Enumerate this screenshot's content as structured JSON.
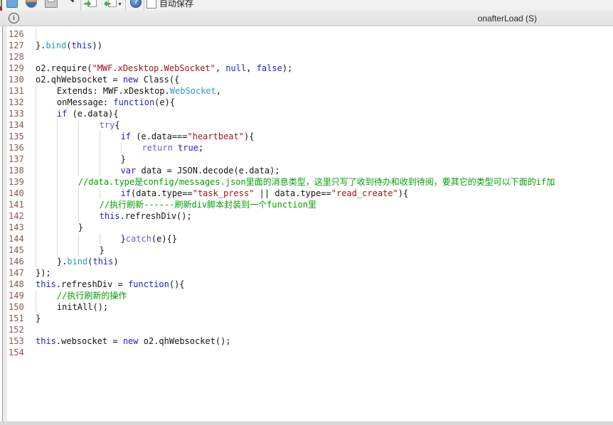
{
  "toolbar": {
    "autosave_label": "自动保存",
    "icons": [
      "new-document-icon",
      "globe-icon",
      "print-icon",
      "format-wand-icon",
      "export-document-icon",
      "import-document-icon",
      "help-icon"
    ]
  },
  "infobar": {
    "label": "onafterLoad (S)",
    "info_icon": "i"
  },
  "editor": {
    "colors": {
      "p": "#141414",
      "k": "#2121cd",
      "c": "#6f5bd8",
      "s": "#a31515",
      "m": "#00a000",
      "b": "#2e9ab8",
      "linenum": "#8f5252",
      "guide": "#d8d8d8"
    },
    "lines": [
      {
        "n": 126,
        "indent": 1,
        "tokens": []
      },
      {
        "n": 127,
        "indent": 0,
        "tokens": [
          [
            "}.",
            "p"
          ],
          [
            "bind",
            "b"
          ],
          [
            "(",
            "p"
          ],
          [
            "this",
            "k"
          ],
          [
            "))",
            "p"
          ]
        ]
      },
      {
        "n": 128,
        "indent": 0,
        "tokens": []
      },
      {
        "n": 129,
        "indent": 0,
        "tokens": [
          [
            "o2.require(",
            "p"
          ],
          [
            "\"MWF.xDesktop.WebSocket\"",
            "s"
          ],
          [
            ", ",
            "p"
          ],
          [
            "null",
            "k"
          ],
          [
            ", ",
            "p"
          ],
          [
            "false",
            "k"
          ],
          [
            ");",
            "p"
          ]
        ]
      },
      {
        "n": 130,
        "indent": 0,
        "tokens": [
          [
            "o2.qhWebsocket = ",
            "p"
          ],
          [
            "new",
            "k"
          ],
          [
            " Class({",
            "p"
          ]
        ]
      },
      {
        "n": 131,
        "indent": 1,
        "tokens": [
          [
            "Extends: MWF.xDesktop.",
            "p"
          ],
          [
            "WebSocket",
            "b"
          ],
          [
            ",",
            "p"
          ]
        ]
      },
      {
        "n": 132,
        "indent": 1,
        "tokens": [
          [
            "onMessage: ",
            "p"
          ],
          [
            "function",
            "k"
          ],
          [
            "(e){",
            "p"
          ]
        ]
      },
      {
        "n": 133,
        "indent": 1,
        "tokens": [
          [
            "if",
            "k"
          ],
          [
            " (e.data){",
            "p"
          ]
        ]
      },
      {
        "n": 134,
        "indent": 3,
        "tokens": [
          [
            "try",
            "c"
          ],
          [
            "{",
            "p"
          ]
        ]
      },
      {
        "n": 135,
        "indent": 4,
        "tokens": [
          [
            "if",
            "k"
          ],
          [
            " (e.data===",
            "p"
          ],
          [
            "\"heartbeat\"",
            "s"
          ],
          [
            "){",
            "p"
          ]
        ]
      },
      {
        "n": 136,
        "indent": 5,
        "tokens": [
          [
            "return",
            "c"
          ],
          [
            " ",
            "p"
          ],
          [
            "true",
            "k"
          ],
          [
            ";",
            "p"
          ]
        ]
      },
      {
        "n": 137,
        "indent": 4,
        "tokens": [
          [
            "}",
            "p"
          ]
        ]
      },
      {
        "n": 138,
        "indent": 4,
        "tokens": [
          [
            "var",
            "k"
          ],
          [
            " data = JSON.decode(e.data);",
            "p"
          ]
        ]
      },
      {
        "n": 139,
        "indent": 2,
        "tokens": [
          [
            "//data.type是config/messages.json里面的消息类型，这里只写了收到待办和收到待阅，要其它的类型可以下面的if加",
            "m"
          ]
        ]
      },
      {
        "n": 140,
        "indent": 4,
        "tokens": [
          [
            "if",
            "k"
          ],
          [
            "(data.type==",
            "p"
          ],
          [
            "\"task_press\"",
            "s"
          ],
          [
            " || data.type==",
            "p"
          ],
          [
            "\"read_create\"",
            "s"
          ],
          [
            "){",
            "p"
          ]
        ]
      },
      {
        "n": 141,
        "indent": 3,
        "tokens": [
          [
            "//执行刷新------刷新div脚本封装到一个function里",
            "m"
          ]
        ]
      },
      {
        "n": 142,
        "indent": 3,
        "tokens": [
          [
            "this",
            "k"
          ],
          [
            ".refreshDiv();",
            "p"
          ]
        ]
      },
      {
        "n": 143,
        "indent": 2,
        "tokens": [
          [
            "}",
            "p"
          ]
        ]
      },
      {
        "n": 144,
        "indent": 4,
        "tokens": [
          [
            "}",
            "p"
          ],
          [
            "catch",
            "c"
          ],
          [
            "(e){}",
            "p"
          ]
        ]
      },
      {
        "n": 145,
        "indent": 3,
        "tokens": [
          [
            "}",
            "p"
          ]
        ]
      },
      {
        "n": 146,
        "indent": 1,
        "tokens": [
          [
            "}.",
            "p"
          ],
          [
            "bind",
            "b"
          ],
          [
            "(",
            "p"
          ],
          [
            "this",
            "k"
          ],
          [
            ")",
            "p"
          ]
        ]
      },
      {
        "n": 147,
        "indent": 0,
        "tokens": [
          [
            "});",
            "p"
          ]
        ]
      },
      {
        "n": 148,
        "indent": 0,
        "tokens": [
          [
            "this",
            "k"
          ],
          [
            ".refreshDiv = ",
            "p"
          ],
          [
            "function",
            "k"
          ],
          [
            "(){",
            "p"
          ]
        ]
      },
      {
        "n": 149,
        "indent": 1,
        "tokens": [
          [
            "//执行刷新的操作",
            "m"
          ]
        ]
      },
      {
        "n": 150,
        "indent": 1,
        "tokens": [
          [
            "initAll();",
            "p"
          ]
        ]
      },
      {
        "n": 151,
        "indent": 0,
        "tokens": [
          [
            "}",
            "p"
          ]
        ]
      },
      {
        "n": 152,
        "indent": 0,
        "tokens": []
      },
      {
        "n": 153,
        "indent": 0,
        "tokens": [
          [
            "this",
            "k"
          ],
          [
            ".websocket = ",
            "p"
          ],
          [
            "new",
            "k"
          ],
          [
            " o2.qhWebsocket();",
            "p"
          ]
        ]
      },
      {
        "n": 154,
        "indent": 0,
        "tokens": []
      }
    ]
  }
}
